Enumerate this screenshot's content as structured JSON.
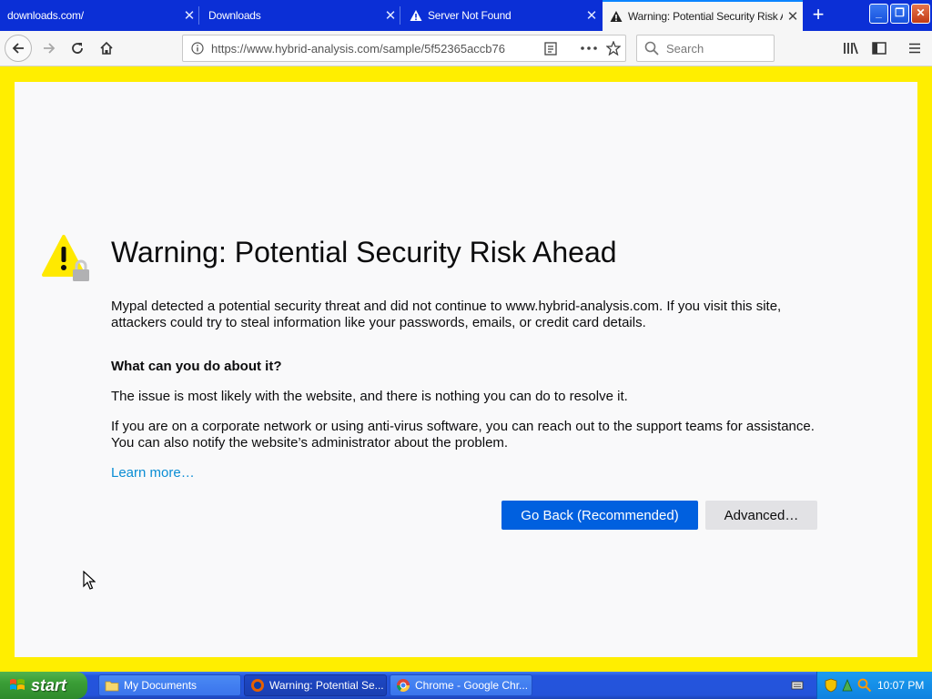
{
  "browser": {
    "tabs": [
      {
        "title": "downloads.com/",
        "active": false
      },
      {
        "title": "Downloads",
        "active": false
      },
      {
        "title": "Server Not Found",
        "active": false
      },
      {
        "title": "Warning: Potential Security Risk A",
        "active": true
      }
    ],
    "url": "https://www.hybrid-analysis.com/sample/5f52365accb76",
    "search_placeholder": "Search"
  },
  "page": {
    "title": "Warning: Potential Security Risk Ahead",
    "intro": "Mypal detected a potential security threat and did not continue to www.hybrid-analysis.com. If you visit this site, attackers could try to steal information like your passwords, emails, or credit card details.",
    "what_heading": "What can you do about it?",
    "issue_text": "The issue is most likely with the website, and there is nothing you can do to resolve it.",
    "corporate_text": "If you are on a corporate network or using anti-virus software, you can reach out to the support teams for assistance. You can also notify the website’s administrator about the problem.",
    "learn_more": "Learn more…",
    "go_back_label": "Go Back (Recommended)",
    "advanced_label": "Advanced…"
  },
  "taskbar": {
    "start_label": "start",
    "tasks": [
      {
        "label": "My Documents",
        "icon": "folder-icon"
      },
      {
        "label": "Warning: Potential Se...",
        "icon": "firefox-icon"
      },
      {
        "label": "Chrome - Google Chr...",
        "icon": "chrome-icon"
      }
    ],
    "clock": "10:07 PM"
  },
  "colors": {
    "page_border": "#ffee00",
    "primary_button": "#0060df",
    "link": "#0a8dd4",
    "tabstrip": "#0b2fd6"
  }
}
